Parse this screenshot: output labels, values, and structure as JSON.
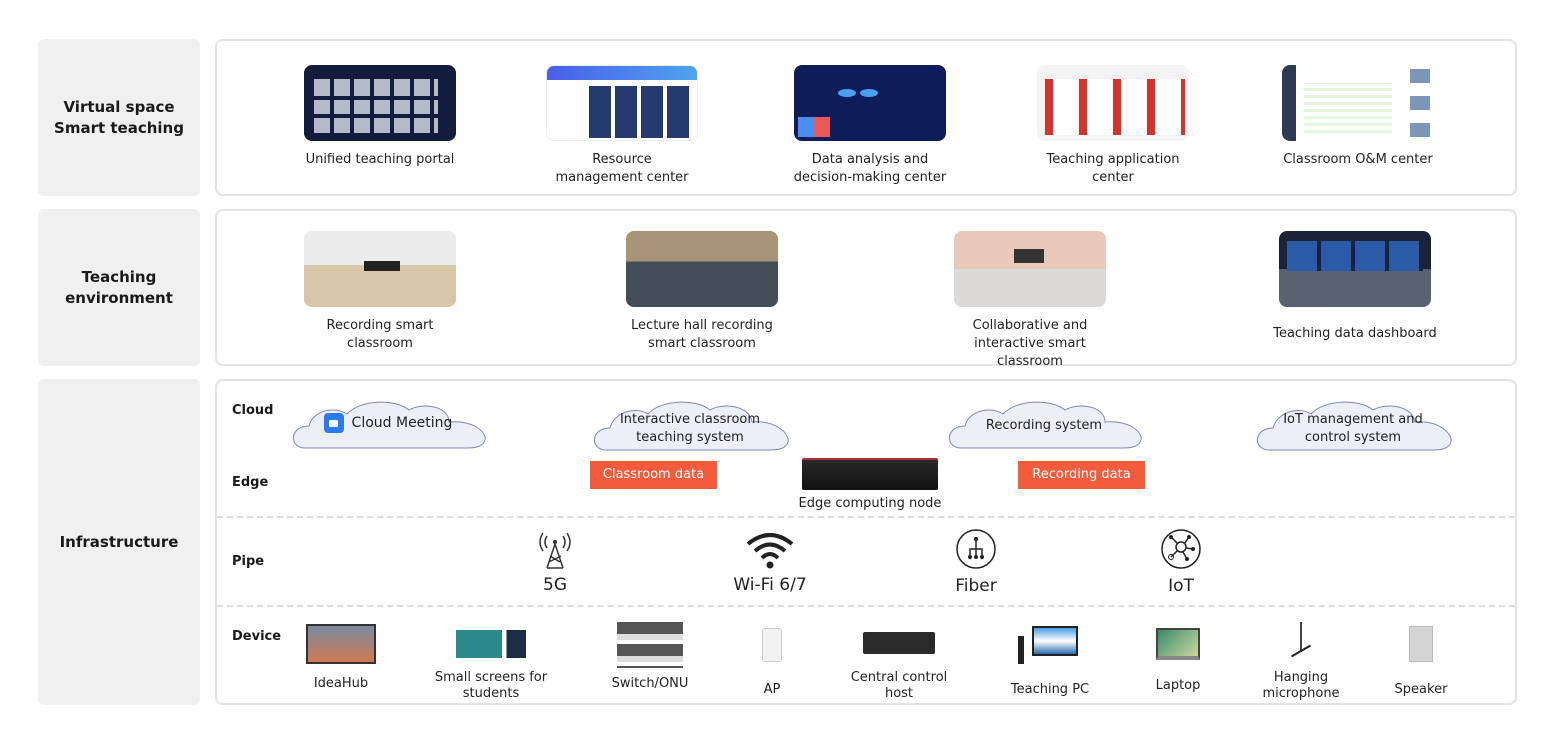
{
  "layers": [
    {
      "label": "Virtual space\nSmart teaching",
      "items": [
        {
          "caption": "Unified teaching portal",
          "image": "portal-screenshot"
        },
        {
          "caption": "Resource management center",
          "image": "resource-screenshot"
        },
        {
          "caption": "Data analysis and decision-making center",
          "image": "dashboard-screenshot"
        },
        {
          "caption": "Teaching application center",
          "image": "apps-screenshot"
        },
        {
          "caption": "Classroom O&M center",
          "image": "om-screenshot"
        }
      ]
    },
    {
      "label": "Teaching environment",
      "items": [
        {
          "caption": "Recording smart classroom",
          "image": "classroom-photo"
        },
        {
          "caption": "Lecture hall recording smart classroom",
          "image": "lecture-hall-photo"
        },
        {
          "caption": "Collaborative and interactive smart classroom",
          "image": "collab-classroom-photo"
        },
        {
          "caption": "Teaching data dashboard",
          "image": "data-dashboard-photo"
        }
      ]
    },
    {
      "label": "Infrastructure"
    }
  ],
  "infra": {
    "sublabels": {
      "cloud": "Cloud",
      "edge": "Edge",
      "pipe": "Pipe",
      "device": "Device"
    },
    "clouds": [
      {
        "text": "Cloud Meeting",
        "icon": "video-camera-icon"
      },
      {
        "text": "Interactive classroom teaching system"
      },
      {
        "text": "Recording system"
      },
      {
        "text": "IoT management and control system"
      }
    ],
    "data_tags": [
      "Classroom data",
      "Recording data"
    ],
    "edge_node": "Edge computing node",
    "pipes": [
      {
        "label": "5G",
        "icon": "cell-tower-icon"
      },
      {
        "label": "Wi-Fi 6/7",
        "icon": "wifi-icon"
      },
      {
        "label": "Fiber",
        "icon": "fiber-icon"
      },
      {
        "label": "IoT",
        "icon": "iot-icon"
      }
    ],
    "devices": [
      {
        "label": "IdeaHub"
      },
      {
        "label": "Small screens for students"
      },
      {
        "label": "Switch/ONU"
      },
      {
        "label": "AP"
      },
      {
        "label": "Central control host"
      },
      {
        "label": "Teaching PC"
      },
      {
        "label": "Laptop"
      },
      {
        "label": "Hanging microphone"
      },
      {
        "label": "Speaker"
      }
    ]
  },
  "colors": {
    "tag": "#f25b3c",
    "label_bg": "#f0f0f0",
    "cloud_fill": "#eceef8",
    "cloud_stroke": "#7f86b8"
  }
}
